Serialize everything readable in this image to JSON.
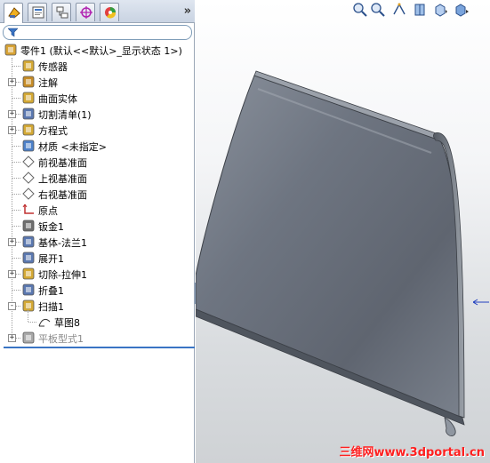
{
  "feature_manager": {
    "tabs": [
      {
        "name": "featuremanager-tab",
        "active": true
      },
      {
        "name": "propertymanager-tab",
        "active": false
      },
      {
        "name": "configurationmanager-tab",
        "active": false
      },
      {
        "name": "dimxpert-tab",
        "active": false
      },
      {
        "name": "display-manager-tab",
        "active": false
      }
    ],
    "expand_label": "»",
    "tree": [
      {
        "label": "零件1   (默认<<默认>_显示状态 1>)",
        "icon": "part-icon",
        "expandable": false
      },
      {
        "label": "传感器",
        "icon": "sensor-icon",
        "expandable": false
      },
      {
        "label": "注解",
        "icon": "annotation-icon",
        "expandable": true
      },
      {
        "label": "曲面实体",
        "icon": "surface-body-icon",
        "expandable": false
      },
      {
        "label": "切割清单(1)",
        "icon": "cut-list-icon",
        "expandable": true
      },
      {
        "label": "方程式",
        "icon": "equation-icon",
        "expandable": true
      },
      {
        "label": "材质 <未指定>",
        "icon": "material-icon",
        "expandable": false
      },
      {
        "label": "前视基准面",
        "icon": "plane-icon",
        "expandable": false
      },
      {
        "label": "上视基准面",
        "icon": "plane-icon",
        "expandable": false
      },
      {
        "label": "右视基准面",
        "icon": "plane-icon",
        "expandable": false
      },
      {
        "label": "原点",
        "icon": "origin-icon",
        "expandable": false
      },
      {
        "label": "钣金1",
        "icon": "sheet-metal-icon",
        "expandable": false
      },
      {
        "label": "基体-法兰1",
        "icon": "base-flange-icon",
        "expandable": true
      },
      {
        "label": "展开1",
        "icon": "unfold-icon",
        "expandable": false
      },
      {
        "label": "切除-拉伸1",
        "icon": "cut-extrude-icon",
        "expandable": true
      },
      {
        "label": "折叠1",
        "icon": "fold-icon",
        "expandable": false
      },
      {
        "label": "扫描1",
        "icon": "sweep-icon",
        "expandable": true,
        "expanded": true
      },
      {
        "label": "草图8",
        "icon": "sketch-icon",
        "expandable": false
      },
      {
        "label": "平板型式1",
        "icon": "flat-pattern-icon",
        "expandable": true,
        "suppressed": true
      }
    ]
  },
  "viewport": {
    "toolbar": [
      "zoom-to-fit-icon",
      "zoom-to-area-icon",
      "previous-view-icon",
      "section-view-icon",
      "view-orientation-icon",
      "display-style-icon"
    ],
    "watermark": "三维网www.3dportal.cn"
  },
  "colors": {
    "accent": "#3a74c4",
    "watermark": "#ff2020",
    "part_fill": "#6d7480"
  }
}
